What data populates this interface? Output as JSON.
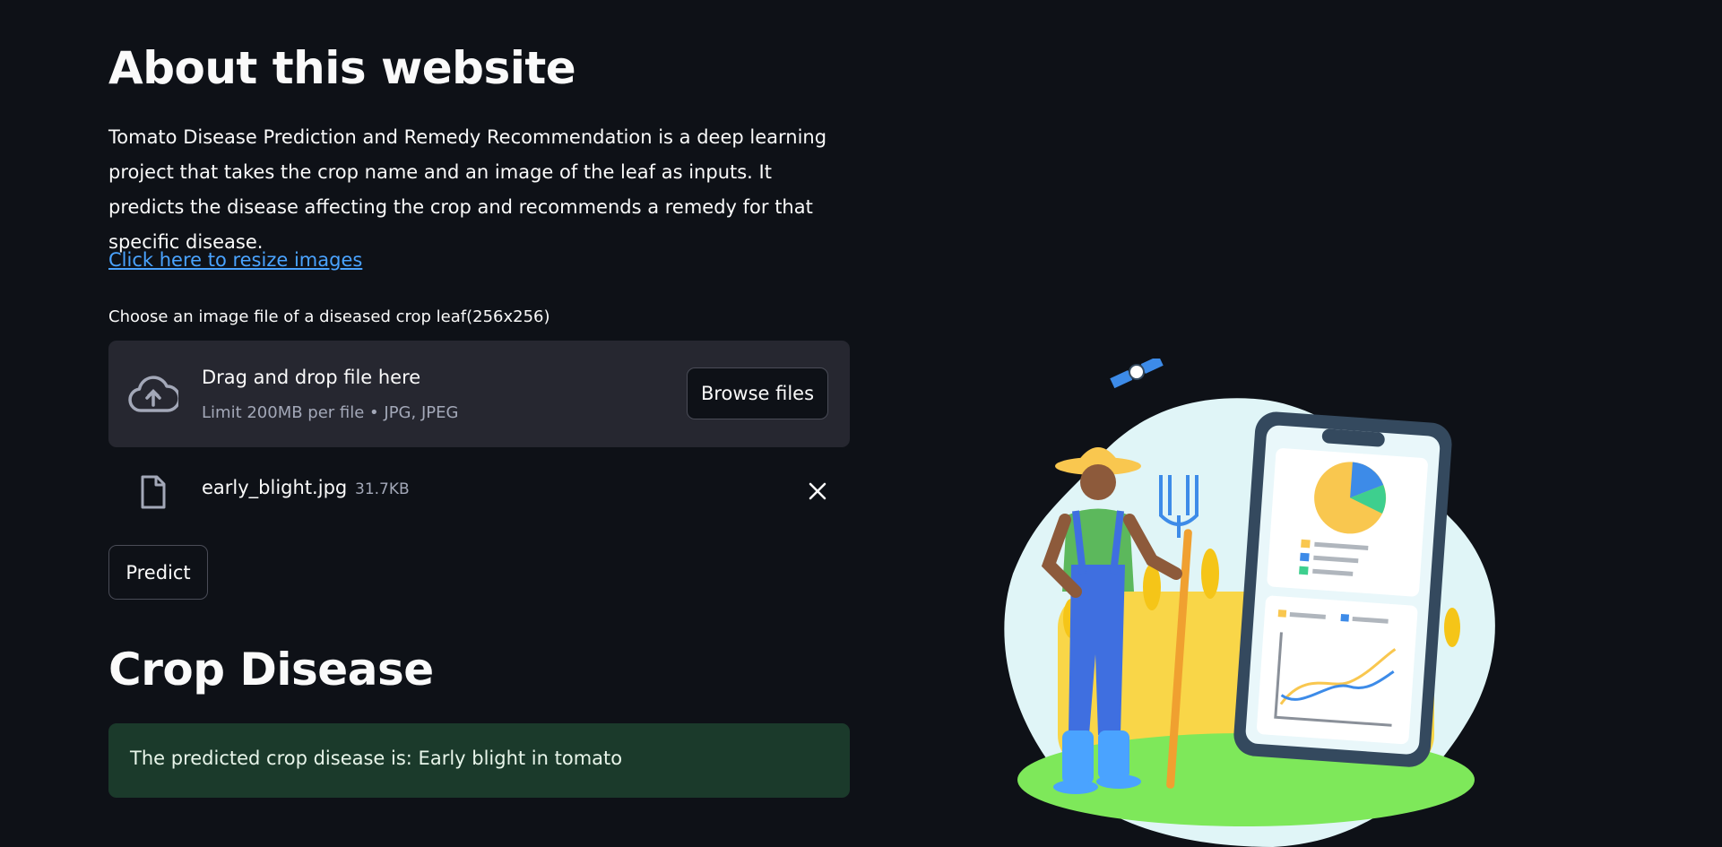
{
  "about": {
    "title": "About this website",
    "description": "Tomato Disease Prediction and Remedy Recommendation is a deep learning project that takes the crop name and an image of the leaf as inputs. It predicts the disease affecting the crop and recommends a remedy for that specific disease.",
    "link_text": "Click here to resize images"
  },
  "uploader": {
    "label": "Choose an image file of a diseased crop leaf(256x256)",
    "drop_title": "Drag and drop file here",
    "drop_subtitle": "Limit 200MB per file • JPG, JPEG",
    "browse_label": "Browse files",
    "cloud_icon": "cloud-upload-icon",
    "file": {
      "name": "early_blight.jpg",
      "size": "31.7KB",
      "icon": "file-icon",
      "remove_icon": "close-icon"
    }
  },
  "predict": {
    "label": "Predict"
  },
  "result": {
    "title": "Crop Disease",
    "message": "The predicted crop disease is: Early blight in tomato"
  },
  "colors": {
    "background": "#0e1117",
    "link": "#4aa3ff",
    "dropzone": "#262730",
    "success_bg": "#1b3a2b",
    "illustration_blob": "#e0f5f7",
    "grass": "#7ee85a"
  }
}
